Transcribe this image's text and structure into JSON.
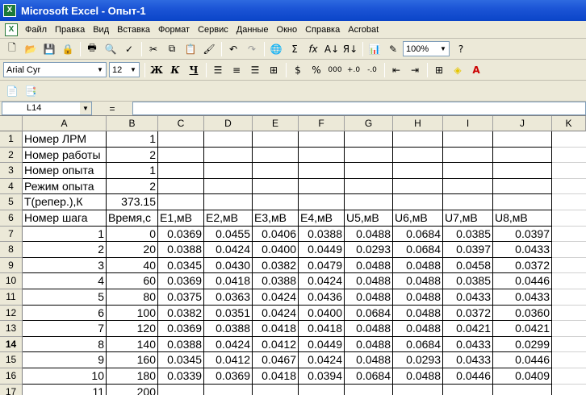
{
  "window": {
    "title": "Microsoft Excel - Опыт-1"
  },
  "menu": [
    "Файл",
    "Правка",
    "Вид",
    "Вставка",
    "Формат",
    "Сервис",
    "Данные",
    "Окно",
    "Справка",
    "Acrobat"
  ],
  "toolbar": {
    "zoom": "100%"
  },
  "format": {
    "font": "Arial Cyr",
    "size": "12"
  },
  "formula_bar": {
    "name_box": "L14",
    "equals": "="
  },
  "columns": [
    "A",
    "B",
    "C",
    "D",
    "E",
    "F",
    "G",
    "H",
    "I",
    "J",
    "K"
  ],
  "rows": [
    {
      "n": "1",
      "a": "Номер ЛРМ",
      "b": "1",
      "v": [
        "",
        "",
        "",
        "",
        "",
        "",
        "",
        ""
      ]
    },
    {
      "n": "2",
      "a": "Номер работы",
      "b": "2",
      "v": [
        "",
        "",
        "",
        "",
        "",
        "",
        "",
        ""
      ]
    },
    {
      "n": "3",
      "a": "Номер опыта",
      "b": "1",
      "v": [
        "",
        "",
        "",
        "",
        "",
        "",
        "",
        ""
      ]
    },
    {
      "n": "4",
      "a": "Режим опыта",
      "b": "2",
      "v": [
        "",
        "",
        "",
        "",
        "",
        "",
        "",
        ""
      ]
    },
    {
      "n": "5",
      "a": "T(репер.),К",
      "b": "373.15",
      "v": [
        "",
        "",
        "",
        "",
        "",
        "",
        "",
        ""
      ]
    },
    {
      "n": "6",
      "a": "Номер шага",
      "b": "Время,с",
      "v": [
        "E1,мВ",
        "E2,мВ",
        "E3,мВ",
        "E4,мВ",
        "U5,мВ",
        "U6,мВ",
        "U7,мВ",
        "U8,мВ"
      ]
    },
    {
      "n": "7",
      "a": "1",
      "b": "0",
      "v": [
        "0.0369",
        "0.0455",
        "0.0406",
        "0.0388",
        "0.0488",
        "0.0684",
        "0.0385",
        "0.0397"
      ]
    },
    {
      "n": "8",
      "a": "2",
      "b": "20",
      "v": [
        "0.0388",
        "0.0424",
        "0.0400",
        "0.0449",
        "0.0293",
        "0.0684",
        "0.0397",
        "0.0433"
      ]
    },
    {
      "n": "9",
      "a": "3",
      "b": "40",
      "v": [
        "0.0345",
        "0.0430",
        "0.0382",
        "0.0479",
        "0.0488",
        "0.0488",
        "0.0458",
        "0.0372"
      ]
    },
    {
      "n": "10",
      "a": "4",
      "b": "60",
      "v": [
        "0.0369",
        "0.0418",
        "0.0388",
        "0.0424",
        "0.0488",
        "0.0488",
        "0.0385",
        "0.0446"
      ]
    },
    {
      "n": "11",
      "a": "5",
      "b": "80",
      "v": [
        "0.0375",
        "0.0363",
        "0.0424",
        "0.0436",
        "0.0488",
        "0.0488",
        "0.0433",
        "0.0433"
      ]
    },
    {
      "n": "12",
      "a": "6",
      "b": "100",
      "v": [
        "0.0382",
        "0.0351",
        "0.0424",
        "0.0400",
        "0.0684",
        "0.0488",
        "0.0372",
        "0.0360"
      ]
    },
    {
      "n": "13",
      "a": "7",
      "b": "120",
      "v": [
        "0.0369",
        "0.0388",
        "0.0418",
        "0.0418",
        "0.0488",
        "0.0488",
        "0.0421",
        "0.0421"
      ]
    },
    {
      "n": "14",
      "a": "8",
      "b": "140",
      "v": [
        "0.0388",
        "0.0424",
        "0.0412",
        "0.0449",
        "0.0488",
        "0.0684",
        "0.0433",
        "0.0299"
      ]
    },
    {
      "n": "15",
      "a": "9",
      "b": "160",
      "v": [
        "0.0345",
        "0.0412",
        "0.0467",
        "0.0424",
        "0.0488",
        "0.0293",
        "0.0433",
        "0.0446"
      ]
    },
    {
      "n": "16",
      "a": "10",
      "b": "180",
      "v": [
        "0.0339",
        "0.0369",
        "0.0418",
        "0.0394",
        "0.0684",
        "0.0488",
        "0.0446",
        "0.0409"
      ]
    },
    {
      "n": "17",
      "a": "11",
      "b": "200",
      "v": [
        "",
        "",
        "",
        "",
        "",
        "",
        "",
        ""
      ]
    }
  ]
}
